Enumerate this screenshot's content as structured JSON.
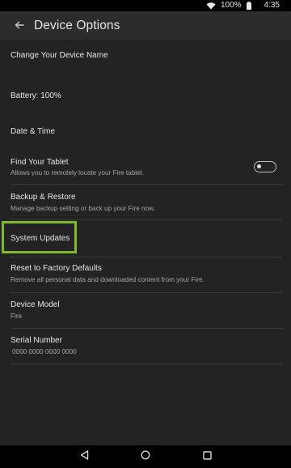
{
  "status_bar": {
    "battery_text": "100%",
    "time": "4:35",
    "icons": [
      "wifi-icon",
      "battery-icon"
    ]
  },
  "app_bar": {
    "title": "Device Options",
    "back_icon": "back-arrow-icon"
  },
  "items": [
    {
      "title": "Change Your Device Name",
      "subtitle": ""
    },
    {
      "title": "Battery: 100%",
      "subtitle": ""
    },
    {
      "title": "Date & Time",
      "subtitle": ""
    },
    {
      "title": "Find Your Tablet",
      "subtitle": "Allows you to remotely locate your Fire tablet.",
      "toggle": "off"
    },
    {
      "title": "Backup & Restore",
      "subtitle": "Manage backup setting or back up your Fire now."
    },
    {
      "title": "System Updates",
      "subtitle": "",
      "highlighted": true
    },
    {
      "title": "Reset to Factory Defaults",
      "subtitle": "Remove all personal data and downloaded content from your Fire."
    },
    {
      "title": "Device Model",
      "subtitle": "Fire"
    },
    {
      "title": "Serial Number",
      "subtitle": "0000 0000 0000 0000"
    }
  ],
  "nav_bar": {
    "icons": [
      "back-triangle-icon",
      "home-circle-icon",
      "recents-square-icon"
    ]
  },
  "colors": {
    "background": "#232323",
    "app_bar": "#2c2c2c",
    "highlight": "#7fba2e",
    "text_primary": "#e6e6e6",
    "text_secondary": "#a6a6a6"
  }
}
